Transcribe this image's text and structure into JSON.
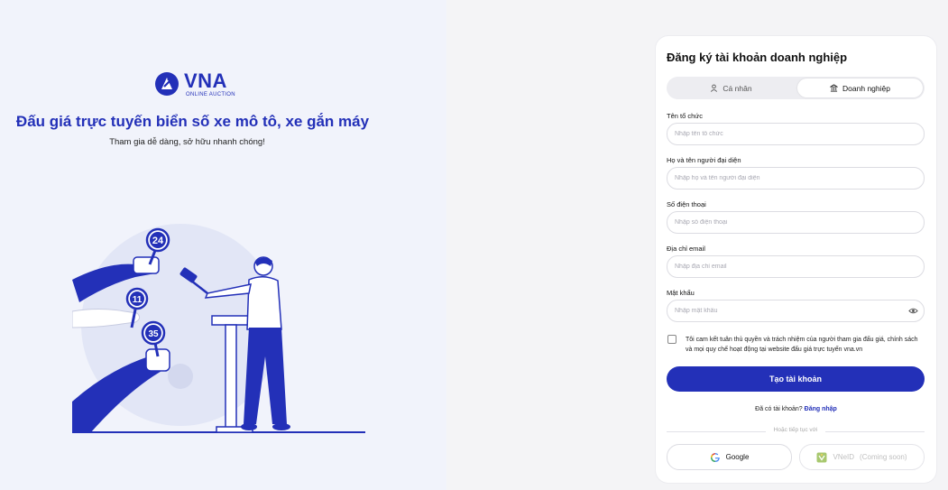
{
  "left": {
    "logo_text": "VNA",
    "logo_sub": "ONLINE AUCTION",
    "headline": "Đấu giá trực tuyến biển số xe mô tô, xe gắn máy",
    "tagline": "Tham gia dễ dàng, sở hữu nhanh chóng!",
    "illustration_numbers": [
      "24",
      "11",
      "35"
    ]
  },
  "form": {
    "title": "Đăng ký tài khoản doanh nghiệp",
    "tabs": [
      {
        "label": "Cá nhân",
        "icon": "user-icon",
        "active": false
      },
      {
        "label": "Doanh nghiệp",
        "icon": "bank-icon",
        "active": true
      }
    ],
    "fields": [
      {
        "label": "Tên tổ chức",
        "placeholder": "Nhập tên tổ chức",
        "value": ""
      },
      {
        "label": "Họ và tên người đại diện",
        "placeholder": "Nhập họ và tên người đại diện",
        "value": ""
      },
      {
        "label": "Số điện thoại",
        "placeholder": "Nhập số điện thoại",
        "value": ""
      },
      {
        "label": "Địa chỉ email",
        "placeholder": "Nhập địa chỉ email",
        "value": ""
      },
      {
        "label": "Mật khẩu",
        "placeholder": "Nhập mật khẩu",
        "value": ""
      }
    ],
    "terms": "Tôi cam kết tuân thủ quyền và trách nhiệm của người tham gia đấu giá, chính sách và mọi quy chế hoạt động tại website đấu giá trực tuyến vna.vn",
    "submit_label": "Tạo tài khoản",
    "have_account": "Đã có tài khoản?",
    "login_label": "Đăng nhập",
    "divider_text": "Hoặc tiếp tục với",
    "google_label": "Google",
    "vneid_label": "VNeID",
    "vneid_note": "(Coming soon)"
  },
  "colors": {
    "brand": "#2330b8",
    "left_bg": "#f1f3fb",
    "page_bg": "#f4f4f6"
  }
}
